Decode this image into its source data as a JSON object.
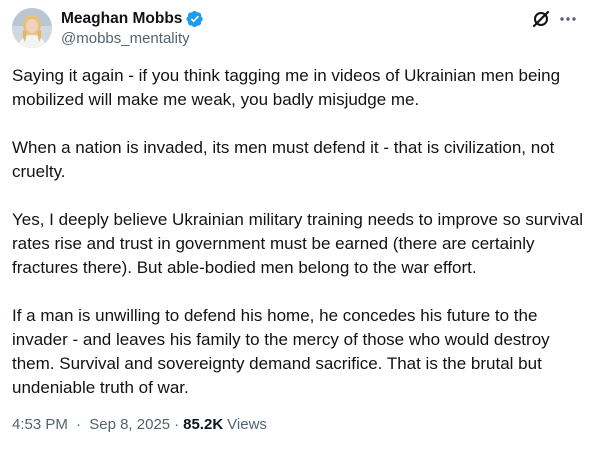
{
  "author": {
    "display_name": "Meaghan Mobbs",
    "handle": "@mobbs_mentality",
    "verified": true
  },
  "icons": {
    "verified": "verified-badge-icon",
    "grok": "grok-icon",
    "more": "more-dots-icon"
  },
  "colors": {
    "verified_blue": "#1d9bf0",
    "secondary_text": "#536471",
    "primary_text": "#0f1419"
  },
  "tweet": {
    "paragraphs": [
      "Saying it again - if you think tagging me in videos of Ukrainian men being mobilized will make me weak, you badly misjudge me.",
      "When a nation is invaded, its men must defend it - that is civilization, not cruelty.",
      "Yes, I deeply believe Ukrainian military training needs to improve so survival rates rise and trust in government must be earned (there are certainly fractures there). But able-bodied men belong to the war effort.",
      "If a man is unwilling to defend his home, he concedes his future to the invader - and leaves his family to the mercy of those who would destroy them. Survival and sovereignty demand sacrifice. That is the brutal but undeniable truth of war."
    ]
  },
  "meta": {
    "time": "4:53 PM",
    "separator": "·",
    "date": "Sep 8, 2025",
    "views_count": "85.2K",
    "views_label": "Views"
  }
}
